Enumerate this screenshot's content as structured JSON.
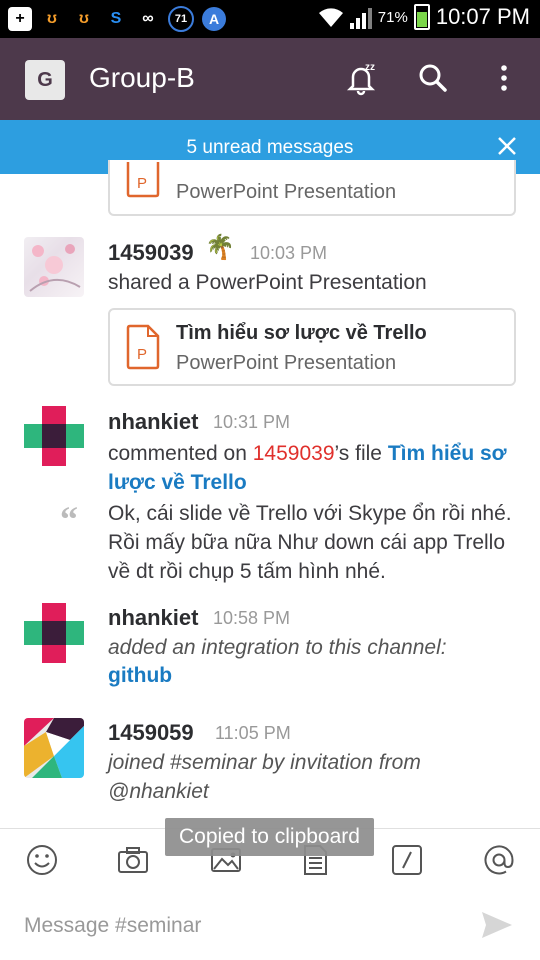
{
  "status_bar": {
    "time": "10:07 PM",
    "battery": "71%",
    "notif_badge": "71"
  },
  "app_bar": {
    "avatar_letter": "G",
    "title": "Group-B"
  },
  "banner": {
    "text": "5 unread messages"
  },
  "attachment_prev": {
    "subtitle": "PowerPoint Presentation"
  },
  "messages": [
    {
      "name": "1459039",
      "emoji": "🌴",
      "time": "10:03 PM",
      "text": "shared a PowerPoint Presentation",
      "attachment": {
        "title": "Tìm hiểu sơ lược về Trello",
        "subtitle": "PowerPoint Presentation"
      }
    },
    {
      "name": "nhankiet",
      "time": "10:31 PM",
      "prefix": "commented on ",
      "user_ref": "1459039",
      "mid": "’s file ",
      "file_link": "Tìm hiểu sơ lược về Trello",
      "quote": "Ok, cái slide về Trello với Skype ổn rồi nhé. Rồi mấy bữa nữa Như down cái app Trello về dt rồi chụp 5 tấm hình nhé."
    },
    {
      "name": "nhankiet",
      "time": "10:58 PM",
      "text": "added an integration to this channel:",
      "link": "github"
    },
    {
      "name": "1459059",
      "time": "11:05 PM",
      "text": "joined #seminar by invitation from @nhankiet"
    }
  ],
  "toast": "Copied to clipboard",
  "input": {
    "placeholder": "Message #seminar"
  },
  "colors": {
    "app_bar": "#4d394b",
    "banner": "#2d9ee0",
    "link": "#1a7bc2",
    "mention": "#e0302c",
    "ppt": "#e0662c"
  },
  "icons": [
    "smiley-icon",
    "camera-icon",
    "image-icon",
    "file-icon",
    "slash-icon",
    "at-icon",
    "send-icon",
    "snooze-bell-icon",
    "search-icon",
    "more-icon",
    "close-icon"
  ]
}
